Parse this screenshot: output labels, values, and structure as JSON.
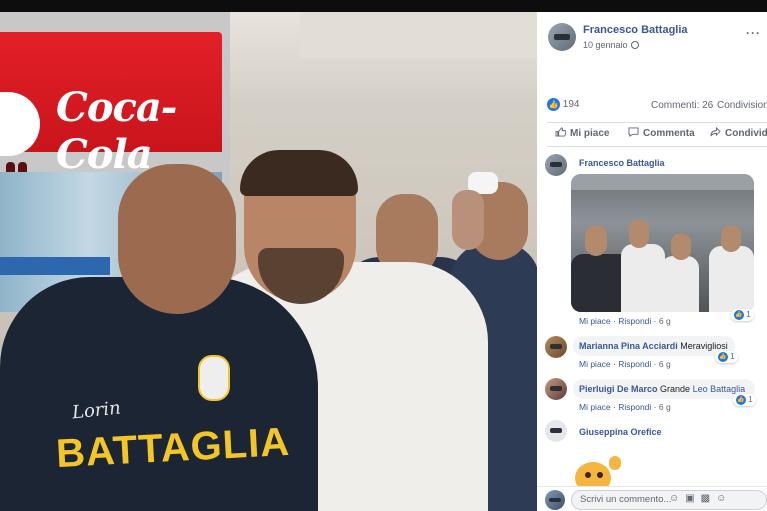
{
  "post": {
    "author": "Francesco Battaglia",
    "date": "10 gennaio",
    "more_label": "···",
    "reaction_count": "194",
    "comments_label": "Commenti: 26",
    "shares_label": "Condivisioni",
    "actions": {
      "like": "Mi piace",
      "comment": "Commenta",
      "share": "Condividi"
    }
  },
  "photo": {
    "fridge_brand": "Coca-Cola",
    "jacket_script": "Lorin",
    "jacket_text": "BATTAGLIA"
  },
  "comments": [
    {
      "author": "Francesco Battaglia",
      "text": "",
      "meta": {
        "like": "Mi piace",
        "reply": "Rispondi",
        "time": "6 g"
      },
      "likes": "1",
      "has_photo": true
    },
    {
      "author": "Marianna Pina Acciardi",
      "text": "Meravigliosi",
      "meta": {
        "like": "Mi piace",
        "reply": "Rispondi",
        "time": "6 g"
      },
      "likes": "1"
    },
    {
      "author": "Pierluigi De Marco",
      "text": "Grande",
      "mention": "Leo Battaglia",
      "meta": {
        "like": "Mi piace",
        "reply": "Rispondi",
        "time": "6 g"
      },
      "likes": "1"
    },
    {
      "author": "Giuseppina Orefice",
      "text": "",
      "has_sticker": true
    }
  ],
  "composer": {
    "placeholder": "Scrivi un commento..."
  },
  "colors": {
    "link": "#385898",
    "like_blue": "#1877f2",
    "coke_red": "#e32028",
    "jacket_yellow": "#f3c526"
  }
}
